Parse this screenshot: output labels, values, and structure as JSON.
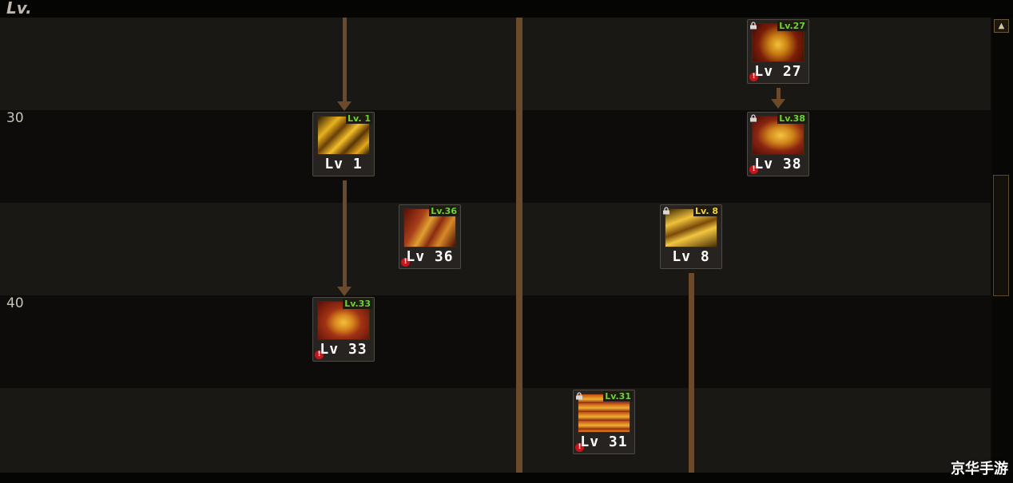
{
  "header": {
    "lv_label": "Lv."
  },
  "rows": [
    {
      "label": "30"
    },
    {
      "label": "40"
    }
  ],
  "skills": [
    {
      "id": "s1",
      "label": "Lv 1",
      "badge": "Lv. 1",
      "locked": false,
      "warning": false,
      "tone": "gold"
    },
    {
      "id": "s27",
      "label": "Lv 27",
      "badge": "Lv.27",
      "locked": true,
      "warning": true,
      "tone": "red"
    },
    {
      "id": "s38",
      "label": "Lv 38",
      "badge": "Lv.38",
      "locked": true,
      "warning": true,
      "tone": "red"
    },
    {
      "id": "s36",
      "label": "Lv 36",
      "badge": "Lv.36",
      "locked": false,
      "warning": true,
      "tone": "red"
    },
    {
      "id": "s8",
      "label": "Lv 8",
      "badge": "Lv. 8",
      "locked": true,
      "warning": false,
      "tone": "gold"
    },
    {
      "id": "s33",
      "label": "Lv 33",
      "badge": "Lv.33",
      "locked": false,
      "warning": true,
      "tone": "red"
    },
    {
      "id": "s31",
      "label": "Lv 31",
      "badge": "Lv.31",
      "locked": true,
      "warning": true,
      "tone": "red"
    }
  ],
  "scrollbar": {
    "up_icon": "chevron-up-icon"
  },
  "watermark": {
    "text": "京华手游"
  },
  "colors": {
    "connector": "#6a4a2a",
    "badge_text": "#6cd432",
    "warning": "#c4161c"
  }
}
